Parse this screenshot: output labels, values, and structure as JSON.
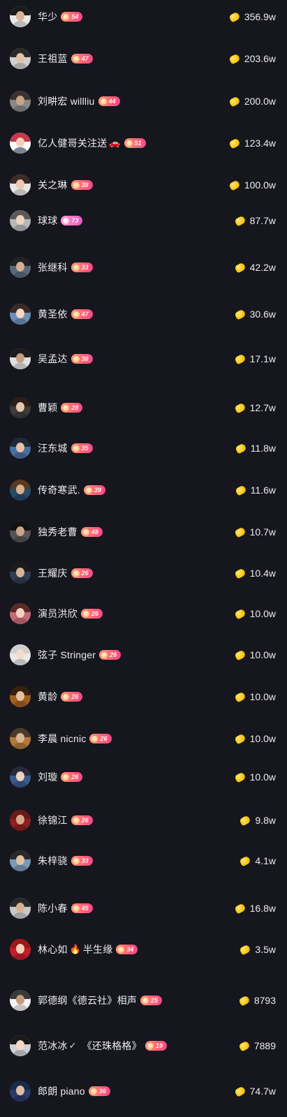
{
  "colors": {
    "background": "#16161e",
    "text": "#ececf0",
    "badge": "#ff5f78",
    "badge_pink": "#f56fc2",
    "bean": "#f8c814"
  },
  "icons": {
    "currency": "gold-bean-icon",
    "badge_prefix": "fan-level-orb-icon"
  },
  "rows": [
    {
      "name": "华少",
      "level": "54",
      "score": "356.9w"
    },
    {
      "name": "王祖蓝",
      "level": "47",
      "score": "203.6w"
    },
    {
      "name": "刘畊宏 willliu",
      "level": "44",
      "score": "200.0w"
    },
    {
      "name": "亿人健哥关注送",
      "emoji": "🚗",
      "level": "51",
      "score": "123.4w"
    },
    {
      "name": "关之琳",
      "level": "38",
      "score": "100.0w"
    },
    {
      "name": "球球",
      "level": "73",
      "score": "87.7w",
      "badge_style": "pink"
    },
    {
      "name": "张继科",
      "level": "33",
      "score": "42.2w"
    },
    {
      "name": "黄圣依",
      "level": "47",
      "score": "30.6w"
    },
    {
      "name": "吴孟达",
      "level": "38",
      "score": "17.1w"
    },
    {
      "name": "曹颖",
      "level": "28",
      "score": "12.7w"
    },
    {
      "name": "汪东城",
      "level": "35",
      "score": "11.8w"
    },
    {
      "name": "传奇寒武.",
      "level": "39",
      "score": "11.6w"
    },
    {
      "name": "独秀老曹",
      "level": "48",
      "score": "10.7w"
    },
    {
      "name": "王耀庆",
      "level": "26",
      "score": "10.4w"
    },
    {
      "name": "演员洪欣",
      "level": "26",
      "score": "10.0w"
    },
    {
      "name": "弦子 Stringer",
      "level": "26",
      "score": "10.0w"
    },
    {
      "name": "黄龄",
      "level": "26",
      "score": "10.0w"
    },
    {
      "name": "李晨 nicnic",
      "level": "26",
      "score": "10.0w"
    },
    {
      "name": "刘璇",
      "level": "26",
      "score": "10.0w"
    },
    {
      "name": "徐锦江",
      "level": "26",
      "score": "9.8w"
    },
    {
      "name": "朱梓骁",
      "level": "33",
      "score": "4.1w"
    },
    {
      "name": "陈小春",
      "level": "45",
      "score": "16.8w"
    },
    {
      "name": "林心如",
      "emoji": "🔥",
      "name_suffix": "半生缘",
      "level": "34",
      "score": "3.5w"
    },
    {
      "name": "郭德纲《德云社》相声",
      "level": "25",
      "score": "8793"
    },
    {
      "name": "范冰冰",
      "check": "✓",
      "name_suffix": "《还珠格格》",
      "level": "19",
      "score": "7889"
    },
    {
      "name": "郎朗 piano",
      "level": "36",
      "score": "74.7w"
    }
  ]
}
